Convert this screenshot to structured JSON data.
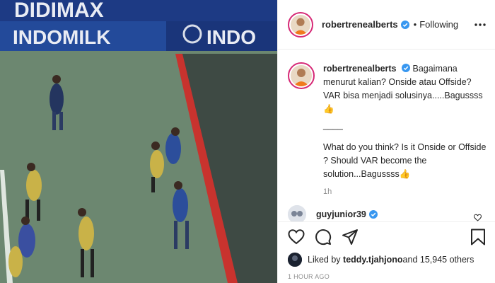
{
  "media": {
    "banners": [
      "DIDIMAX",
      "INDOMILK",
      "INDO"
    ]
  },
  "post": {
    "author": "robertrenealberts",
    "separator": "•",
    "follow_label": "Following",
    "caption_lines": [
      "Bagaimana menurut kalian? Onside atau Offside? VAR bisa menjadi solusinya.....Bagussss 👍",
      "____",
      "What do you think? Is it Onside or Offside ? Should VAR become the solution...Bagussss👍"
    ],
    "caption_time": "1h",
    "comment_user": "guyjunior39",
    "likes_prefix": "Liked by ",
    "liked_by_user": "teddy.tjahjono",
    "likes_suffix": " and 15,945 others",
    "posted_ago": "1 HOUR AGO"
  },
  "icons": {
    "more": "more-options-icon",
    "verified": "verified-badge-icon",
    "like": "heart-icon",
    "comment": "comment-icon",
    "share": "share-icon",
    "save": "bookmark-icon"
  },
  "colors": {
    "verified": "#3897f0",
    "avatar_ring": "#d62976",
    "muted": "#8e8e8e",
    "pitch": "#6f8a73"
  }
}
